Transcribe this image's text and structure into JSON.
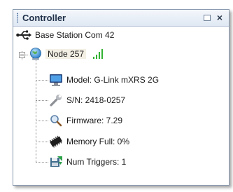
{
  "panel": {
    "title": "Controller"
  },
  "tree": {
    "base_station": {
      "label": "Base Station Com 42",
      "icon": "usb-connection-icon"
    },
    "node": {
      "label": "Node 257",
      "icon": "globe-node-icon",
      "signal_icon": "signal-strength-icon",
      "expanded": true,
      "children": [
        {
          "label": "Model: G-Link mXRS 2G",
          "icon": "monitor-icon"
        },
        {
          "label": "S/N: 2418-0257",
          "icon": "wrench-icon"
        },
        {
          "label": "Firmware: 7.29",
          "icon": "magnifier-icon"
        },
        {
          "label": "Memory Full: 0%",
          "icon": "memory-chip-icon"
        },
        {
          "label": "Num Triggers: 1",
          "icon": "trigger-save-icon"
        }
      ]
    }
  },
  "colors": {
    "signal": "#33b133",
    "titlebar_text": "#1e2f48",
    "node_highlight": "#f3efe4"
  }
}
